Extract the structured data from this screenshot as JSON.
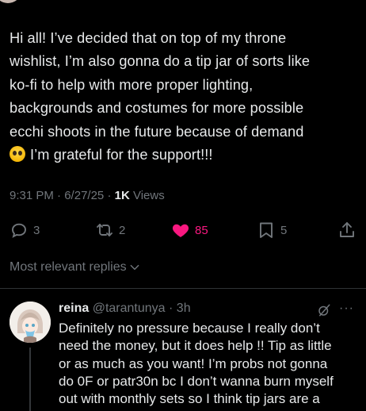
{
  "post": {
    "lines": [
      "Hi all! I’ve decided that on top of my throne",
      "wishlist, I’m also gonna do a tip jar of sorts like",
      "ko-fi to help with more proper lighting,",
      "backgrounds and costumes for more possible",
      "ecchi shoots in the future because of demand",
      "I’m grateful for the support!!!"
    ],
    "emoji": "pleading-face",
    "time": "9:31 PM",
    "date": "6/27/25",
    "views_count": "1K",
    "views_label": "Views"
  },
  "actions": {
    "replies": "3",
    "reposts": "2",
    "likes": "85",
    "bookmarks": "5"
  },
  "replies_sort": {
    "label": "Most relevant replies"
  },
  "reply": {
    "name": "reina",
    "handle": "@tarantunya",
    "time": "3h",
    "lines": [
      "Definitely no pressure because I really don’t",
      "need the money, but it does help !! Tip as little",
      "or as much as you want! I’m probs not gonna",
      "do 0F or patr30n bc I don’t wanna burn myself",
      "out with monthly sets so I think tip jars are a"
    ]
  },
  "colors": {
    "background": "#000000",
    "text": "#e7e9ea",
    "muted": "#71767b",
    "like": "#f91880",
    "divider": "#2f3336"
  }
}
